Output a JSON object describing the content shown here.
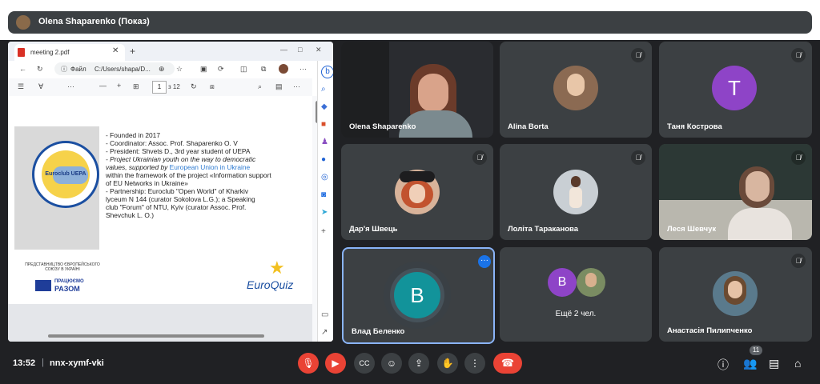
{
  "header": {
    "presenter_label": "Olena Shaparenko (Показ)"
  },
  "browser": {
    "tab_title": "meeting 2.pdf",
    "address_prefix": "Файл",
    "address": "C:/Users/shapa/D...",
    "page_number": "1",
    "page_total": "з 12"
  },
  "slide": {
    "lines": [
      "- Founded in 2017",
      "- Coordinator: Assoc. Prof. Shaparenko O. V",
      "- President: Shvets D., 3rd year student of UEPA",
      "- Project  Ukrainian youth on the way to democratic",
      "values, supported by",
      "European Union in Ukraine",
      "within the framework of the project «Information support",
      "of EU Networks in Ukraine»",
      "- Partnership:   Euroclub \"Open World\" of Kharkiv",
      "lyceum N 144 (curator Sokolova L.G.); a Speaking",
      "club \"Forum\" of NTU, Kyiv (curator  Assoc. Prof.",
      "Shevchuk L. O.)"
    ],
    "logo_text": "Euroclub UEPA",
    "rep_text": "ПРЕДСТАВНИЦТВО ЄВРОПЕЙСЬКОГО СОЮЗУ В УКРАЇНІ",
    "razom_text_1": "ПРАЦЮЄМО",
    "razom_text_2": "РАЗОМ",
    "euroquiz_text": "EuroQuiz"
  },
  "participants": [
    {
      "name": "Olena Shaparenko",
      "muted": false
    },
    {
      "name": "Alina Borta",
      "muted": true
    },
    {
      "name": "Таня Кострова",
      "muted": true,
      "letter": "T",
      "color": "#8e44c7"
    },
    {
      "name": "Дар'я Швець",
      "muted": true
    },
    {
      "name": "Лоліта Тараканова",
      "muted": true
    },
    {
      "name": "Леся Шевчук",
      "muted": true
    },
    {
      "name": "Влад Беленко",
      "muted": false,
      "letter": "B",
      "color": "#12939a"
    },
    {
      "name": "Ещё 2 чел.",
      "letter": "B",
      "color": "#8e44c7"
    },
    {
      "name": "Анастасія Пилипченко",
      "muted": true
    }
  ],
  "bottom": {
    "time": "13:52",
    "separator": "|",
    "meeting_code": "nnx-xymf-vki",
    "people_count": "11"
  },
  "colors": {
    "accent_blue": "#8ab4f8",
    "red": "#ea4335",
    "tile": "#3c4043",
    "background": "#202124"
  }
}
